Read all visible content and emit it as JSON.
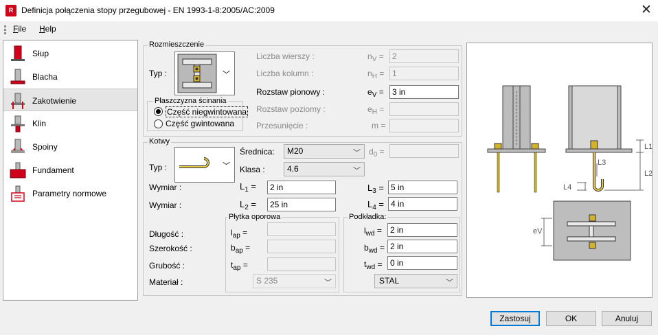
{
  "window": {
    "icon_letter": "R",
    "title": "Definicja połączenia stopy przegubowej - EN 1993-1-8:2005/AC:2009",
    "close_glyph": "✕"
  },
  "menu": {
    "file": "File",
    "help": "Help"
  },
  "sidebar": {
    "items": [
      {
        "label": "Słup",
        "icon": "column-icon"
      },
      {
        "label": "Blacha",
        "icon": "base-plate-icon"
      },
      {
        "label": "Zakotwienie",
        "icon": "anchorage-icon",
        "selected": true
      },
      {
        "label": "Klin",
        "icon": "shear-key-icon"
      },
      {
        "label": "Spoiny",
        "icon": "welds-icon"
      },
      {
        "label": "Fundament",
        "icon": "foundation-icon"
      },
      {
        "label": "Parametry normowe",
        "icon": "code-parameters-icon"
      }
    ]
  },
  "layout_group": {
    "title": "Rozmieszczenie",
    "type_label": "Typ :",
    "rows_label": "Liczba wierszy :",
    "rows_sym": "n",
    "rows_sub": "V",
    "rows_value": "2",
    "cols_label": "Liczba kolumn :",
    "cols_sym": "n",
    "cols_sub": "H",
    "cols_value": "1",
    "vspacing_label": "Rozstaw pionowy :",
    "vspacing_sym": "e",
    "vspacing_sub": "V",
    "vspacing_value": "3 in",
    "hspacing_label": "Rozstaw poziomy :",
    "hspacing_sym": "e",
    "hspacing_sub": "H",
    "hspacing_value": "",
    "offset_label": "Przesunięcie :",
    "offset_sym": "m",
    "offset_value": "",
    "eq": "="
  },
  "shear_plane": {
    "title": "Płaszczyzna ścinania",
    "option1": "Część niegwintowana",
    "option2": "Część gwintowana",
    "selected": "option1"
  },
  "anchors": {
    "title": "Kotwy",
    "type_label": "Typ :",
    "diameter_label": "Średnica:",
    "diameter_value": "M20",
    "d0_sym": "d",
    "d0_sub": "0",
    "d0_value": "",
    "class_label": "Klasa :",
    "class_value": "4.6",
    "dim_label1": "Wymiar :",
    "dim_label2": "Wymiar :",
    "l1_sym": "L",
    "l1_sub": "1",
    "l1_value": "2 in",
    "l2_sym": "L",
    "l2_sub": "2",
    "l2_value": "25 in",
    "l3_sym": "L",
    "l3_sub": "3",
    "l3_value": "5 in",
    "l4_sym": "L",
    "l4_sub": "4",
    "l4_value": "4 in",
    "eq": "="
  },
  "bearing_plate": {
    "title": "Płytka oporowa",
    "length_label": "Długość :",
    "width_label": "Szerokość :",
    "thickness_label": "Grubość :",
    "material_label": "Materiał :",
    "lap_sym": "l",
    "lap_sub": "ap",
    "lap_value": "",
    "bap_sym": "b",
    "bap_sub": "ap",
    "bap_value": "",
    "tap_sym": "t",
    "tap_sub": "ap",
    "tap_value": "",
    "material_value": "S 235",
    "eq": "="
  },
  "washer": {
    "title": "Podkładka:",
    "lwd_sym": "l",
    "lwd_sub": "wd",
    "lwd_value": "2 in",
    "bwd_sym": "b",
    "bwd_sub": "wd",
    "bwd_value": "2 in",
    "twd_sym": "t",
    "twd_sub": "wd",
    "twd_value": "0 in",
    "material_value": "STAL",
    "eq": "="
  },
  "preview": {
    "labels": {
      "l1": "L1",
      "l2": "L2",
      "l3": "L3",
      "l4": "L4",
      "ev": "eV"
    }
  },
  "buttons": {
    "apply": "Zastosuj",
    "ok": "OK",
    "cancel": "Anuluj"
  },
  "colors": {
    "accent": "#0078d7",
    "anchor": "#d4b12c",
    "brand": "#d0021b"
  }
}
